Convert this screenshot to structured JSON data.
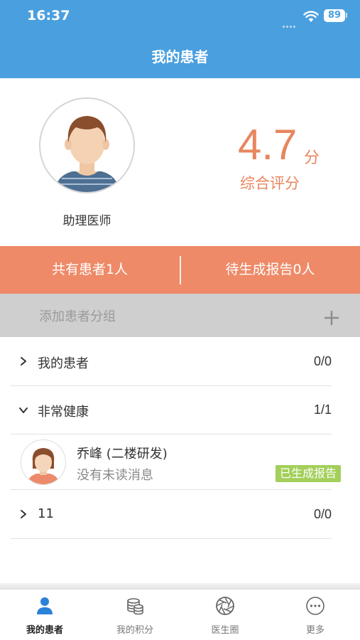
{
  "status_bar": {
    "time": "16:37",
    "battery": "89"
  },
  "header": {
    "title": "我的患者"
  },
  "profile": {
    "role": "助理医师",
    "score": "4.7",
    "score_unit": "分",
    "score_label": "综合评分"
  },
  "stats": {
    "total_patients": "共有患者1人",
    "pending_reports": "待生成报告0人"
  },
  "add_group": {
    "label": "添加患者分组"
  },
  "groups": [
    {
      "name": "我的患者",
      "count": "0/0",
      "expanded": false
    },
    {
      "name": "非常健康",
      "count": "1/1",
      "expanded": true
    },
    {
      "name": "11",
      "count": "0/0",
      "expanded": false
    }
  ],
  "patients": [
    {
      "name": "乔峰 (二楼研发)",
      "message": "没有未读消息",
      "badge": "已生成报告"
    }
  ],
  "tabbar": {
    "items": [
      {
        "label": "我的患者",
        "icon": "person-icon",
        "active": true
      },
      {
        "label": "我的积分",
        "icon": "coins-icon",
        "active": false
      },
      {
        "label": "医生圈",
        "icon": "aperture-icon",
        "active": false
      },
      {
        "label": "更多",
        "icon": "more-icon",
        "active": false
      }
    ]
  },
  "colors": {
    "header": "#4a9fdf",
    "accent": "#e8865e",
    "stats_bar": "#ee8a68",
    "badge": "#a3cf5a",
    "tab_active": "#2b82d9"
  }
}
